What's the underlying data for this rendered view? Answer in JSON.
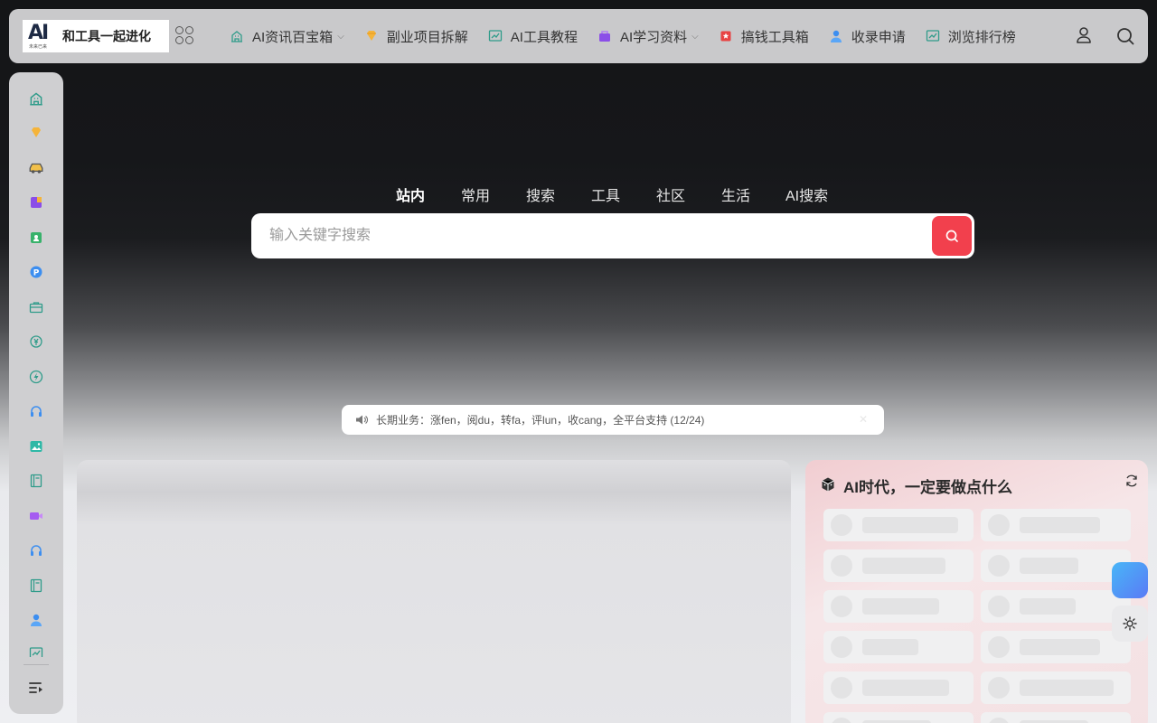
{
  "header": {
    "logo_mark": "AI",
    "logo_sub": "未来已来",
    "logo_text": "和工具一起进化",
    "nav": [
      {
        "label": "AI资讯百宝箱",
        "icon": "building-icon",
        "has_dropdown": true
      },
      {
        "label": "副业项目拆解",
        "icon": "diamond-icon",
        "has_dropdown": false
      },
      {
        "label": "AI工具教程",
        "icon": "chart-icon",
        "has_dropdown": false
      },
      {
        "label": "AI学习资料",
        "icon": "purple-box-icon",
        "has_dropdown": true
      },
      {
        "label": "搞钱工具箱",
        "icon": "red-flag-icon",
        "has_dropdown": false
      },
      {
        "label": "收录申请",
        "icon": "person-icon",
        "has_dropdown": false
      },
      {
        "label": "浏览排行榜",
        "icon": "chart-icon",
        "has_dropdown": false
      }
    ]
  },
  "sidebar": {
    "items": [
      {
        "icon": "building-icon"
      },
      {
        "icon": "diamond-icon"
      },
      {
        "icon": "car-icon"
      },
      {
        "icon": "purple-book-icon"
      },
      {
        "icon": "green-person-icon"
      },
      {
        "icon": "p-badge-icon"
      },
      {
        "icon": "briefcase-icon"
      },
      {
        "icon": "money-icon"
      },
      {
        "icon": "bolt-icon"
      },
      {
        "icon": "headset-icon"
      },
      {
        "icon": "image-icon"
      },
      {
        "icon": "book-icon"
      },
      {
        "icon": "video-icon"
      },
      {
        "icon": "headset-icon"
      },
      {
        "icon": "book-icon"
      },
      {
        "icon": "person-icon"
      },
      {
        "icon": "chart-icon"
      }
    ]
  },
  "search": {
    "tabs": [
      "站内",
      "常用",
      "搜索",
      "工具",
      "社区",
      "生活",
      "AI搜索"
    ],
    "active_tab": 0,
    "placeholder": "输入关键字搜索",
    "value": ""
  },
  "notice": {
    "text": "长期业务：涨fen，阅du，转fa，评lun，收cang，全平台支持 (12/24)"
  },
  "right_card": {
    "title": "AI时代，一定要做点什么"
  },
  "colors": {
    "accent_red": "#f2404d",
    "blue_float": "#4c8ff7"
  }
}
